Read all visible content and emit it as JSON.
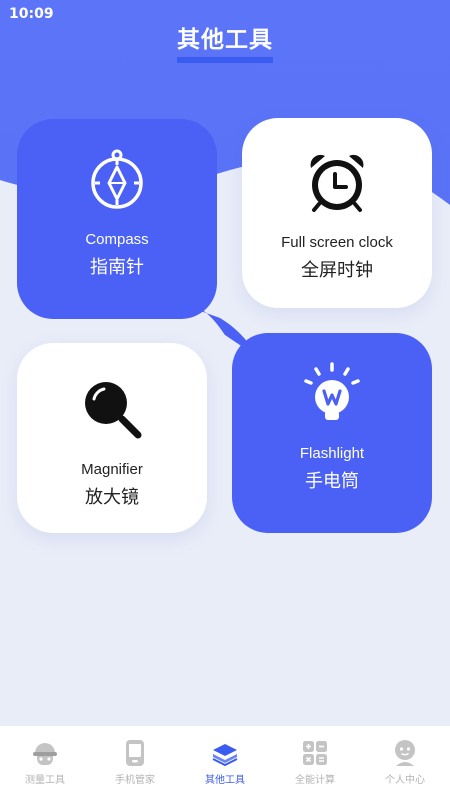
{
  "status": {
    "time": "10:09"
  },
  "header": {
    "title": "其他工具"
  },
  "tools": [
    {
      "en": "Compass",
      "cn": "指南针",
      "icon": "compass-icon"
    },
    {
      "en": "Full screen clock",
      "cn": "全屏时钟",
      "icon": "alarm-clock-icon"
    },
    {
      "en": "Magnifier",
      "cn": "放大镜",
      "icon": "magnifier-icon"
    },
    {
      "en": "Flashlight",
      "cn": "手电筒",
      "icon": "lightbulb-icon"
    }
  ],
  "tabbar": {
    "active_index": 2,
    "items": [
      {
        "label": "测量工具",
        "icon": "measure-face-icon"
      },
      {
        "label": "手机管家",
        "icon": "phone-icon"
      },
      {
        "label": "其他工具",
        "icon": "layers-icon"
      },
      {
        "label": "全能计算",
        "icon": "calculator-icon"
      },
      {
        "label": "个人中心",
        "icon": "person-icon"
      }
    ]
  },
  "colors": {
    "primary": "#4b60f5",
    "active_tab": "#3b5cf0",
    "inactive_tab": "#b3b3b3",
    "background": "#e9edf8"
  }
}
